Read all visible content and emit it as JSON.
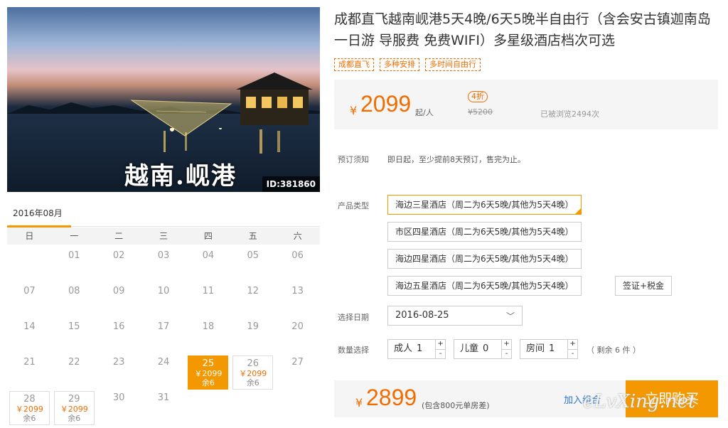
{
  "hero": {
    "caption": "越南.岘港",
    "id_badge": "ID:381860"
  },
  "calendar": {
    "month": "2016年08月",
    "weekdays": [
      "日",
      "一",
      "二",
      "三",
      "四",
      "五",
      "六"
    ],
    "days": [
      {
        "d": "",
        "col": 0
      },
      {
        "d": "01"
      },
      {
        "d": "02"
      },
      {
        "d": "03"
      },
      {
        "d": "04"
      },
      {
        "d": "05"
      },
      {
        "d": "06"
      },
      {
        "d": "07"
      },
      {
        "d": "08"
      },
      {
        "d": "09"
      },
      {
        "d": "10"
      },
      {
        "d": "11"
      },
      {
        "d": "12"
      },
      {
        "d": "13"
      },
      {
        "d": "14"
      },
      {
        "d": "15"
      },
      {
        "d": "16"
      },
      {
        "d": "17"
      },
      {
        "d": "18"
      },
      {
        "d": "19"
      },
      {
        "d": "20"
      },
      {
        "d": "21"
      },
      {
        "d": "22"
      },
      {
        "d": "23"
      },
      {
        "d": "24"
      },
      {
        "d": "25",
        "price": "￥2099",
        "left": "余6",
        "selected": true
      },
      {
        "d": "26",
        "price": "￥2099",
        "left": "余6"
      },
      {
        "d": "27"
      },
      {
        "d": "28",
        "price": "￥2099",
        "left": "余6"
      },
      {
        "d": "29",
        "price": "￥2099",
        "left": "余6"
      },
      {
        "d": "30"
      },
      {
        "d": "31"
      }
    ]
  },
  "product": {
    "title": "成都直飞越南岘港5天4晚/6天5晚半自由行（含会安古镇迦南岛一日游 导服费 免费WIFI）多星级酒店档次可选",
    "tags": [
      "成都直飞",
      "多种安排",
      "多时间自由行"
    ]
  },
  "price": {
    "currency": "¥",
    "value": "2099",
    "unit": "起/人",
    "discount": "4折",
    "original": "¥5200",
    "views": "已被浏览2494次"
  },
  "booking_notice": {
    "label": "预订须知",
    "text": "即日起，至少提前8天预订，售完为止。"
  },
  "product_type": {
    "label": "产品类型",
    "options": [
      "海边三星酒店（周二为6天5晚/其他为5天4晚）",
      "市区四星酒店（周二为6天5晚/其他为5天4晚）",
      "海边四星酒店（周二为6天5晚/其他为5天4晚）",
      "海边五星酒店（周二为6天5晚/其他为5天4晚）"
    ],
    "extra": "签证+税金",
    "selected_index": 0
  },
  "date": {
    "label": "选择日期",
    "value": "2016-08-25"
  },
  "quantity": {
    "label": "数量选择",
    "adult": {
      "label": "成人",
      "value": "1"
    },
    "child": {
      "label": "儿童",
      "value": "0"
    },
    "room": {
      "label": "房间",
      "value": "1"
    },
    "plus": "+",
    "minus": "-",
    "remaining": "（ 剩余 6 件 ）"
  },
  "buy": {
    "currency": "¥",
    "total": "2899",
    "note": "(包含800元单房差)",
    "combo": "加入组合",
    "button": "立即购买"
  },
  "watermark": "eLvXing.net",
  "colors": {
    "accent": "#f39800",
    "price": "#f36c00",
    "link": "#2a77c9"
  }
}
